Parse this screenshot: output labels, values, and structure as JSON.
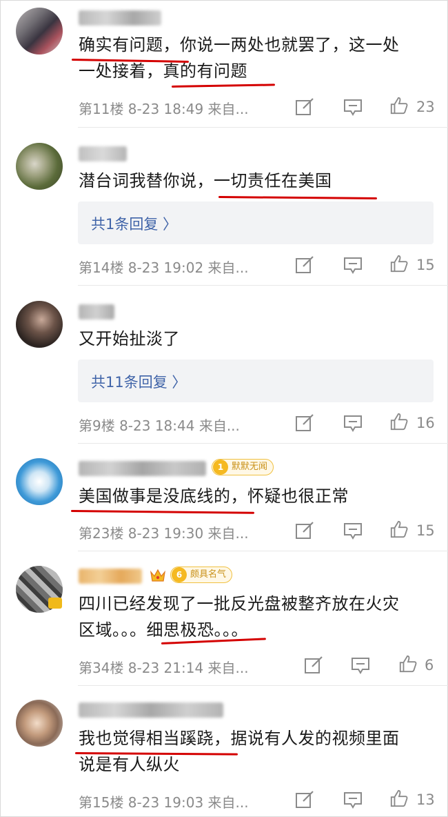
{
  "comments": [
    {
      "text_lines": [
        "确实有问题，你说一两处也就罢了，这一处",
        "一处接着，真的有问题"
      ],
      "meta": "第11楼 8-23 18:49 来自...",
      "likes": "23",
      "reply_label": ""
    },
    {
      "text_lines": [
        "潜台词我替你说，一切责任在美国"
      ],
      "meta": "第14楼 8-23 19:02 来自...",
      "likes": "15",
      "reply_label": "共1条回复 〉"
    },
    {
      "text_lines": [
        "又开始扯淡了"
      ],
      "meta": "第9楼 8-23 18:44 来自...",
      "likes": "16",
      "reply_label": "共11条回复 〉"
    },
    {
      "text_lines": [
        "美国做事是没底线的，怀疑也很正常"
      ],
      "meta": "第23楼 8-23 19:30 来自...",
      "likes": "15",
      "badge": {
        "level": "1",
        "label": "默默无闻"
      }
    },
    {
      "text_lines": [
        "四川已经发现了一批反光盘被整齐放在火灾",
        "区域。。。细思极恐。。。"
      ],
      "meta": "第34楼 8-23 21:14 来自...",
      "likes": "6",
      "badge": {
        "level": "6",
        "label": "颇具名气"
      }
    },
    {
      "text_lines": [
        "我也觉得相当蹊跷，据说有人发的视频里面",
        "说是有人纵火"
      ],
      "meta": "第15楼 8-23 19:03 来自...",
      "likes": "13"
    }
  ],
  "icons": {
    "edit": "edit-icon",
    "comment": "comment-icon",
    "like": "thumbs-up-icon"
  },
  "colors": {
    "link": "#3f63a8",
    "meta": "#8a8a8a",
    "underline": "#d40000",
    "badge_gold": "#f5b921"
  }
}
